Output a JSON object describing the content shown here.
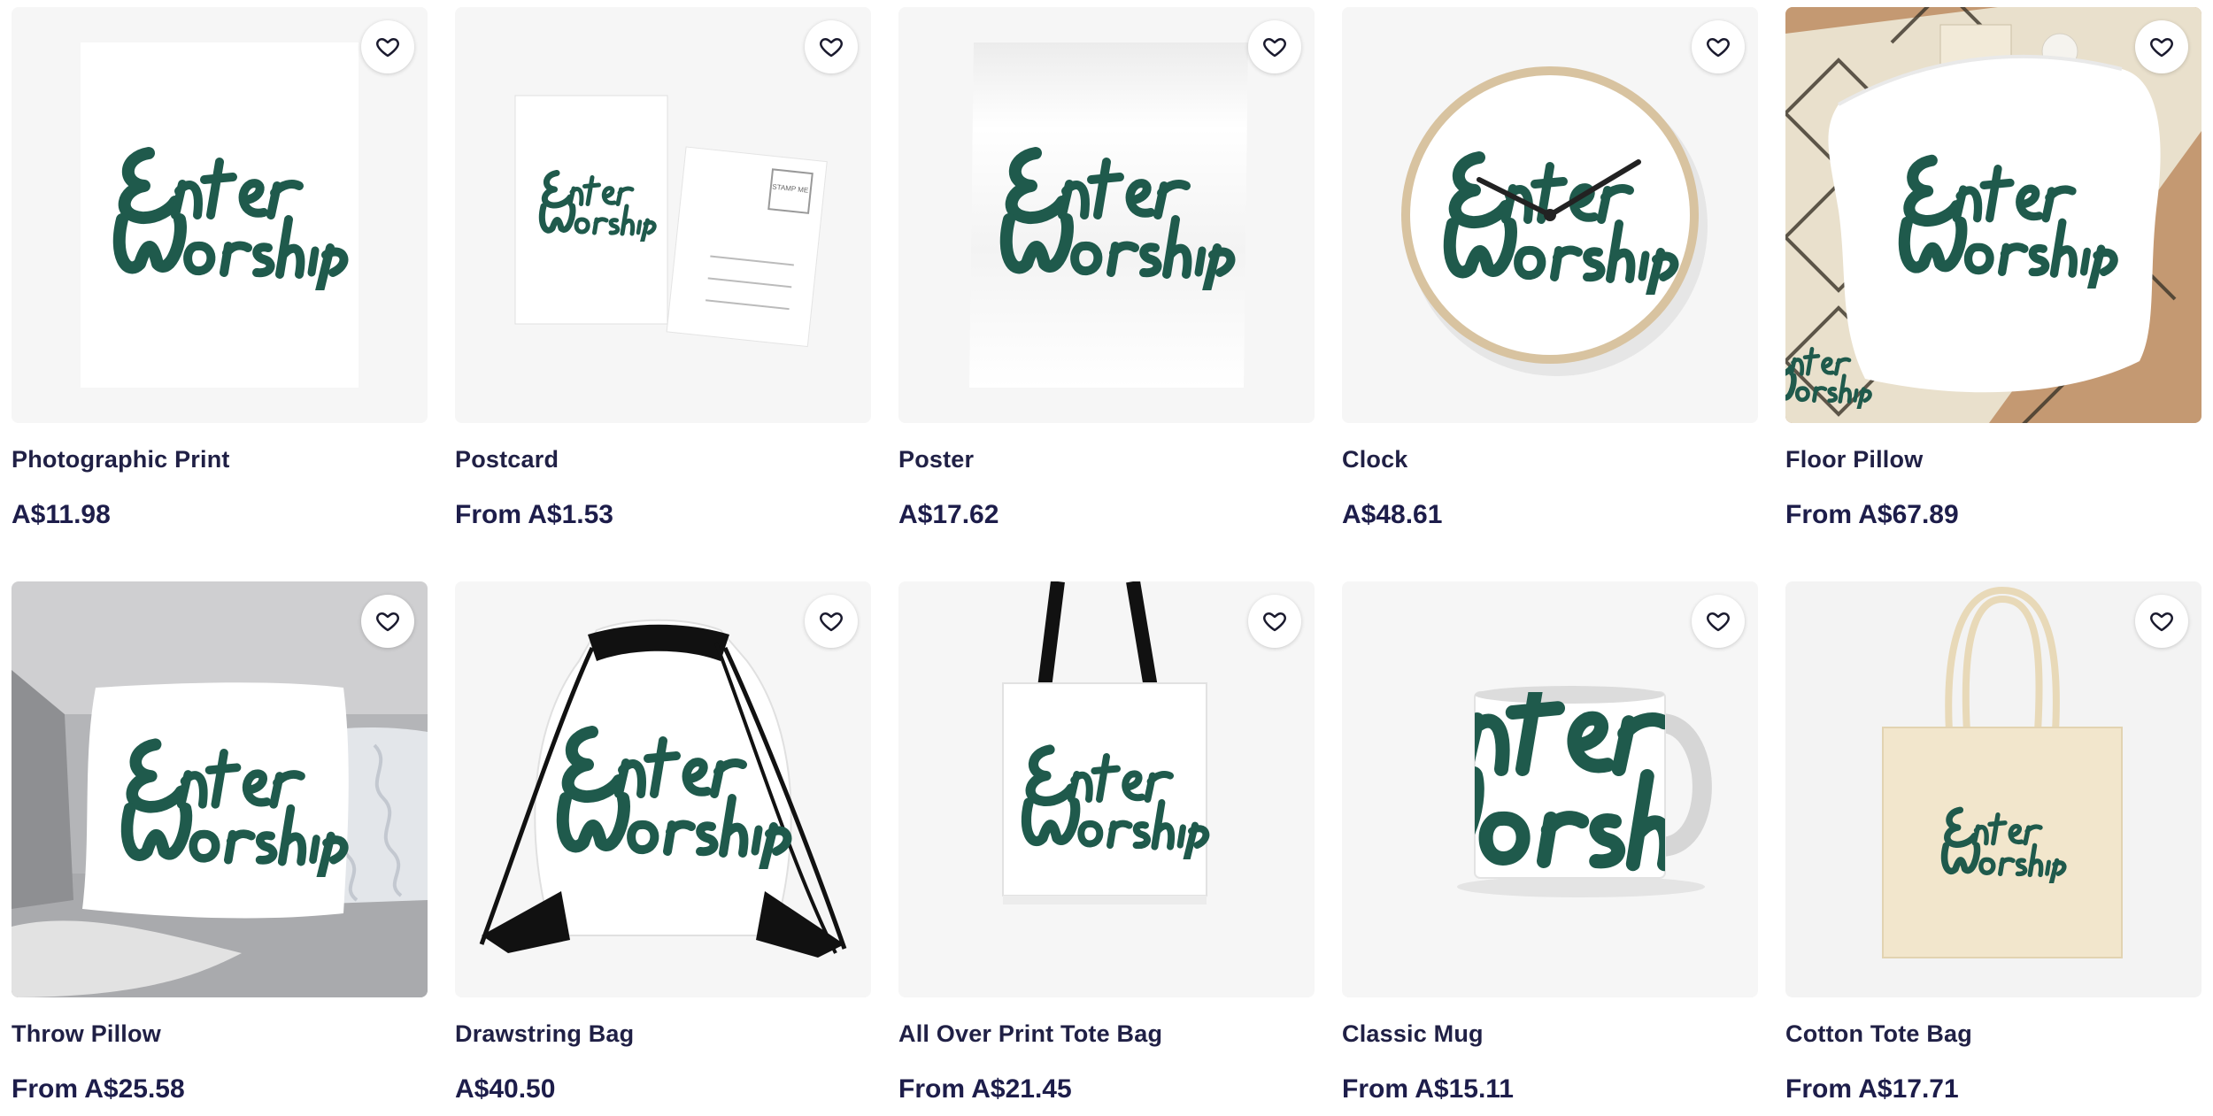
{
  "brand_color": "#1f5a4c",
  "logo_text": "Enter Worship",
  "favorite_icon": "heart-outline-icon",
  "products": [
    {
      "title": "Photographic Print",
      "price": "A$11.98"
    },
    {
      "title": "Postcard",
      "price": "From A$1.53"
    },
    {
      "title": "Poster",
      "price": "A$17.62"
    },
    {
      "title": "Clock",
      "price": "A$48.61"
    },
    {
      "title": "Floor Pillow",
      "price": "From A$67.89"
    },
    {
      "title": "Throw Pillow",
      "price": "From A$25.58"
    },
    {
      "title": "Drawstring Bag",
      "price": "A$40.50"
    },
    {
      "title": "All Over Print Tote Bag",
      "price": "From A$21.45"
    },
    {
      "title": "Classic Mug",
      "price": "From A$15.11"
    },
    {
      "title": "Cotton Tote Bag",
      "price": "From A$17.71"
    }
  ],
  "postcard": {
    "stamp_text": "STAMP ME"
  }
}
